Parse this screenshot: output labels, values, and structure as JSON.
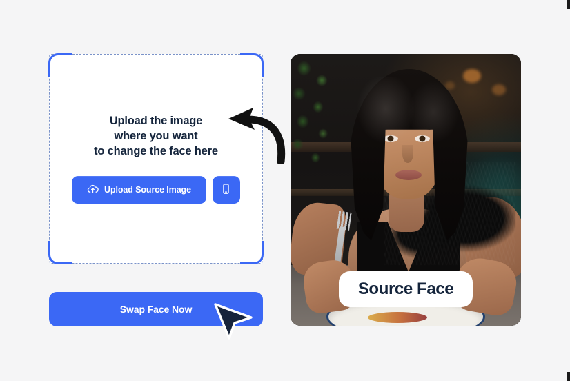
{
  "theme": {
    "page_background": "#f5f5f6",
    "accent_blue": "#3b68f5",
    "dashed_border": "#7b93c9",
    "text_dark_navy": "#14243b",
    "label_pill_background": "#ffffff"
  },
  "upload_panel": {
    "headline": "Upload the image\nwhere you want\nto change the face here",
    "upload_button_label": "Upload Source Image",
    "upload_icon": "cloud-upload-icon",
    "phone_button_icon": "mobile-phone-icon",
    "submit_button_label": "Swap Face Now",
    "corner_brackets": [
      "top-left",
      "top-right",
      "bottom-left",
      "bottom-right"
    ]
  },
  "annotations": {
    "arrow_icon": "curved-left-arrow-icon",
    "cursor_icon": "mouse-pointer-cursor-icon"
  },
  "preview_panel": {
    "badge_label": "Source Face",
    "image_alt": "Portrait photo of a woman with long dark hair seated at a restaurant table holding a fork over a plate"
  }
}
